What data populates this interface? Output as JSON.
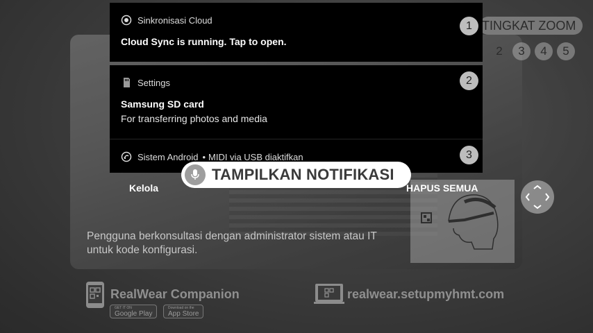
{
  "zoom": {
    "label": "TINGKAT ZOOM",
    "levels": [
      "2",
      "3",
      "4",
      "5"
    ]
  },
  "notifications": [
    {
      "app": "Sinkronisasi Cloud",
      "title": "Cloud Sync is running. Tap to open.",
      "number": "1",
      "icon": "cloud-sync-icon"
    },
    {
      "app": "Settings",
      "title": "Samsung SD card",
      "body": "For transferring photos and media",
      "number": "2",
      "icon": "sd-card-icon"
    },
    {
      "app": "Sistem Android",
      "separator": "•",
      "detail": "MIDI via USB diaktifkan",
      "number": "3",
      "icon": "android-system-icon"
    }
  ],
  "voice_command": {
    "text": "TAMPILKAN NOTIFIKASI",
    "icon": "microphone-icon"
  },
  "actions": {
    "manage": "Kelola",
    "clear_all": "HAPUS SEMUA"
  },
  "help_text": "Pengguna berkonsultasi dengan administrator sistem atau IT untuk kode konfigurasi.",
  "companion": {
    "title": "RealWear Companion",
    "google_play_small": "GET IT ON",
    "google_play": "Google Play",
    "app_store_small": "Download on the",
    "app_store": "App Store"
  },
  "url": "realwear.setupmyhmt.com",
  "colors": {
    "notification_bg": "#000000",
    "badge": "#bdbdbd",
    "pill": "#ffffff"
  }
}
